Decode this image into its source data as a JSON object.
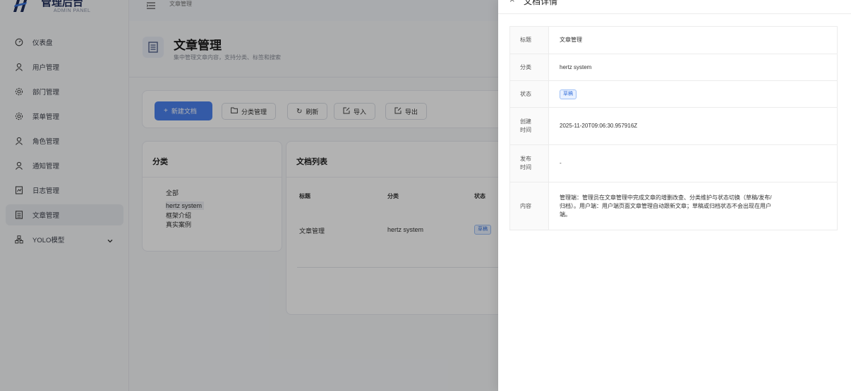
{
  "colors": {
    "primary": "#4b82ee",
    "brand": "#1f2d5a",
    "tag_blue": "#3a74db"
  },
  "brand": {
    "title": "管理后台",
    "subtitle": "ADMIN PANEL"
  },
  "sidebar": {
    "items": [
      {
        "label": "仪表盘",
        "icon": "dashboard-icon"
      },
      {
        "label": "用户管理",
        "icon": "user-icon"
      },
      {
        "label": "部门管理",
        "icon": "gear-icon"
      },
      {
        "label": "菜单管理",
        "icon": "gear-icon"
      },
      {
        "label": "角色管理",
        "icon": "user-icon"
      },
      {
        "label": "通知管理",
        "icon": "user-icon"
      },
      {
        "label": "日志管理",
        "icon": "log-icon"
      },
      {
        "label": "文章管理",
        "icon": "document-icon",
        "active": true
      },
      {
        "label": "YOLO模型",
        "icon": "model-icon",
        "expandable": true
      }
    ]
  },
  "topbar": {
    "breadcrumb": "文章管理"
  },
  "page": {
    "title": "文章管理",
    "description": "集中管理文章内容，支持分类、标签和搜索"
  },
  "toolbar": {
    "new_doc": "新建文档",
    "category_manage": "分类管理",
    "refresh": "刷新",
    "import": "导入",
    "export": "导出"
  },
  "categories": {
    "title": "分类",
    "items": [
      "全部",
      "hertz system",
      "框架介绍",
      "真实案例"
    ],
    "selected_index": 1
  },
  "doc_list": {
    "title": "文档列表",
    "columns": [
      "标题",
      "分类",
      "状态"
    ],
    "rows": [
      {
        "title": "文章管理",
        "category": "hertz system",
        "status": "草稿"
      }
    ]
  },
  "drawer": {
    "title": "文档详情",
    "fields": {
      "title_label": "标题",
      "title_value": "文章管理",
      "category_label": "分类",
      "category_value": "hertz system",
      "status_label": "状态",
      "status_value": "草稿",
      "created_label_1": "创建",
      "created_label_2": "时间",
      "created_value": "2025-11-20T09:06:30.957916Z",
      "published_label_1": "发布",
      "published_label_2": "时间",
      "published_value": "-",
      "content_label": "内容",
      "content_value_1": "管理端：管理员在文章管理中完成文章的增删改查、分类维护与状态切换（草稿/发布/",
      "content_value_2": "归档）。用户端：用户端页面文章管理自动跟新文章；草稿或归档状态不会出现在用户",
      "content_value_3": "端。"
    }
  }
}
